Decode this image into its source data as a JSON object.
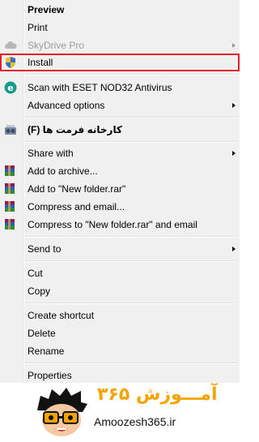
{
  "menu": {
    "items": [
      {
        "id": "preview",
        "label": "Preview",
        "bold": true
      },
      {
        "id": "print",
        "label": "Print"
      },
      {
        "id": "skydrive",
        "label": "SkyDrive Pro",
        "disabled": true,
        "submenu": true,
        "icon": "skydrive-cloud-icon"
      },
      {
        "id": "install",
        "label": "Install",
        "highlighted": true,
        "icon": "uac-shield-icon"
      },
      {
        "id": "eset",
        "label": "Scan with ESET NOD32 Antivirus",
        "icon": "eset-icon"
      },
      {
        "id": "advanced",
        "label": "Advanced options",
        "submenu": true
      },
      {
        "id": "format",
        "label": "کارخانه فرمت ها (F)",
        "icon": "format-factory-icon"
      },
      {
        "id": "share",
        "label": "Share with",
        "submenu": true
      },
      {
        "id": "add-archive",
        "label": "Add to archive...",
        "icon": "winrar-icon"
      },
      {
        "id": "add-rar",
        "label": "Add to \"New folder.rar\"",
        "icon": "winrar-icon"
      },
      {
        "id": "compress-email",
        "label": "Compress and email...",
        "icon": "winrar-icon"
      },
      {
        "id": "compress-rar-email",
        "label": "Compress to \"New folder.rar\" and email",
        "icon": "winrar-icon"
      },
      {
        "id": "send-to",
        "label": "Send to",
        "submenu": true
      },
      {
        "id": "cut",
        "label": "Cut"
      },
      {
        "id": "copy",
        "label": "Copy"
      },
      {
        "id": "create-shortcut",
        "label": "Create shortcut"
      },
      {
        "id": "delete",
        "label": "Delete"
      },
      {
        "id": "rename",
        "label": "Rename"
      },
      {
        "id": "properties",
        "label": "Properties"
      }
    ]
  },
  "watermark": {
    "fa_text": "آمـــوزش ۳۶۵",
    "site": "Amoozesh365.ir",
    "accent_color": "#f5a300",
    "mascot_icon": "glasses-boy-mascot-icon"
  },
  "colors": {
    "menu_bg": "#f0f0f0",
    "highlight_border": "#e3202d",
    "disabled_text": "#9a9a9a"
  }
}
